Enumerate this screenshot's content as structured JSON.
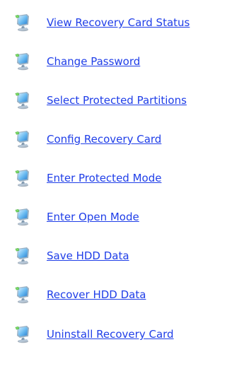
{
  "menu": {
    "items": [
      {
        "label": "View Recovery Card Status",
        "icon": "computer-network-icon"
      },
      {
        "label": "Change Password",
        "icon": "computer-network-icon"
      },
      {
        "label": "Select Protected Partitions",
        "icon": "computer-network-icon"
      },
      {
        "label": "Config Recovery Card",
        "icon": "computer-network-icon"
      },
      {
        "label": "Enter Protected Mode",
        "icon": "computer-network-icon"
      },
      {
        "label": "Enter Open Mode",
        "icon": "computer-network-icon"
      },
      {
        "label": "Save HDD Data",
        "icon": "computer-network-icon"
      },
      {
        "label": "Recover HDD Data",
        "icon": "computer-network-icon"
      },
      {
        "label": "Uninstall Recovery Card",
        "icon": "computer-network-icon"
      }
    ]
  },
  "colors": {
    "link": "#1f3ee8",
    "background": "#ffffff"
  }
}
